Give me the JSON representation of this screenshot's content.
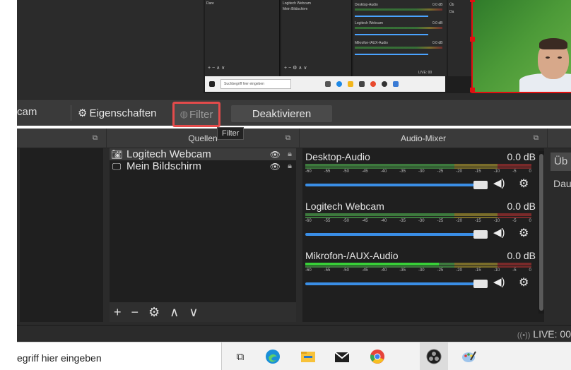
{
  "preview": {
    "mini_sources": [
      "Logitech Webcam",
      "Mein Bildschirm"
    ],
    "mini_top_left_label": "Dare",
    "mini_mixer": [
      {
        "name": "Desktop-Audio",
        "db": "0.0 dB"
      },
      {
        "name": "Logitech Webcam",
        "db": "0.0 dB"
      },
      {
        "name": "Mikrofon-/AUX-Audio",
        "db": "0.0 dB"
      }
    ],
    "mini_controls_left": "+ − ∧ ∨",
    "mini_controls_right": "+ − ⚙ ∧ ∨",
    "mini_live": "LIVE: 00",
    "mini_search_placeholder": "Suchbegriff hier eingeben",
    "mini_right_labels": [
      "Üb",
      "Da"
    ]
  },
  "toolbar": {
    "cam_label": "cam",
    "eigenschaften_label": "Eigenschaften",
    "filter_label": "Filter",
    "deaktivieren_label": "Deaktivieren",
    "tooltip": "Filter"
  },
  "docks": {
    "sources_title": "Quellen",
    "mixer_title": "Audio-Mixer",
    "float_icon": "⧉"
  },
  "sources": {
    "items": [
      {
        "label": "Logitech Webcam",
        "icon": "camera-icon"
      },
      {
        "label": "Mein Bildschirm",
        "icon": "monitor-icon"
      }
    ],
    "footer": {
      "add": "+",
      "remove": "−",
      "settings": "⚙",
      "up": "∧",
      "down": "∨"
    }
  },
  "mixer": {
    "ticks": [
      "-60",
      "-55",
      "-50",
      "-45",
      "-40",
      "-35",
      "-30",
      "-25",
      "-20",
      "-15",
      "-10",
      "-5",
      "0"
    ],
    "channels": [
      {
        "name": "Desktop-Audio",
        "db": "0.0 dB",
        "level_pct": 0
      },
      {
        "name": "Logitech Webcam",
        "db": "0.0 dB",
        "level_pct": 0
      },
      {
        "name": "Mikrofon-/AUX-Audio",
        "db": "0.0 dB",
        "level_pct": 58
      }
    ]
  },
  "controls": {
    "button_label": "Üb",
    "label": "Dau"
  },
  "status": {
    "live_icon": "((•))",
    "live_label": "LIVE: 00"
  },
  "taskbar": {
    "search_text": "egriff hier eingeben",
    "apps": [
      "task-view-icon",
      "edge-icon",
      "file-explorer-icon",
      "mail-icon",
      "chrome-icon",
      "obs-icon",
      "paint-icon"
    ]
  }
}
